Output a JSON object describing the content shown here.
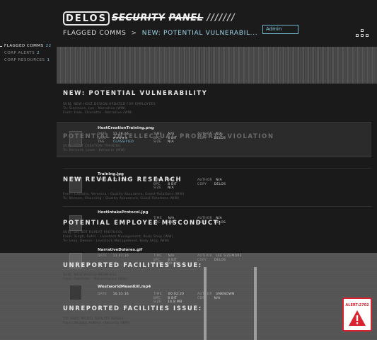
{
  "header": {
    "logo": "DELOS",
    "panel_title_word1": "SECURITY",
    "panel_title_word2": "PANEL",
    "panel_title_hashes": "///////",
    "admin_label": "Admin"
  },
  "breadcrumb": {
    "root": "FLAGGED COMMS",
    "separator": ">",
    "current": "NEW: POTENTIAL VULNERABIL..."
  },
  "sidebar": {
    "items": [
      {
        "label": "FLAGGED COMMS",
        "count": "22"
      },
      {
        "label": "CORP ALERTS",
        "count": "2"
      },
      {
        "label": "CORP RESOURCES",
        "count": "1"
      }
    ]
  },
  "messages": [
    {
      "title": "NEW: POTENTIAL VULNERABILITY",
      "lines": [
        "SUBJ: NEW HOST DESIGN UPDATED FOR EMPLOYEES",
        "To: Sizemore, Lee - Narrative (WW)",
        "From: Hale, Charlotte - Narrative (WW)"
      ]
    },
    {
      "title": "POTENTIAL INTELLECTUAL PROPERTY VIOLATION",
      "lines": [
        "SUBJ: HOST CREATION TRAINING",
        "To: Bernard, Lowe - Behavior (WW)"
      ]
    },
    {
      "title": "NEW REVEALING RESEARCH",
      "lines": [
        "From: Costello, Veronica - Quality Assurance, Guest Relations (WW)",
        "To: Benson, Channing - Quality Assurance, Guest Relations (WW)"
      ]
    },
    {
      "title": "POTENTIAL EMPLOYEE MISCONDUCT:",
      "lines": [
        "SUBJ: DO NOT REPEAT PROTOCOL",
        "From: Singh, Rohit - Livestock Management, Body Shop (WW)",
        "To: Levy, Dennis - Livestock Management, Body Shop (WW)"
      ]
    },
    {
      "title": "UNREPORTED FACILITIES ISSUE:",
      "lines": [
        "SUBJ: WESTWORLD MEAN KILL",
        "From: Facilities - Maintenance (WW)"
      ]
    },
    {
      "title": "UNREPORTED FACILITIES ISSUE:",
      "lines": [
        "TO: SUBJ: MODEL QUALITY ISSUES",
        "From: Stubbs, Ashley - Security (WW)"
      ]
    }
  ],
  "attachments": [
    {
      "name": "HostCreationTraining.png",
      "date": "11.28.16",
      "rate": "★★★★★",
      "tag": "CLASSIFIED",
      "time": "N/A",
      "bpc": "8 BIT",
      "size": "N/A",
      "author": "N/A",
      "copy": "DELOS"
    },
    {
      "name": "Training.jpg",
      "date": "11.21.16",
      "rate": "",
      "tag": "",
      "time": "N/A",
      "bpc": "8 BIT",
      "size": "N/A",
      "author": "N/A",
      "copy": "DELOS"
    },
    {
      "name": "HostIntakeProtocol.jpg",
      "date": "11.14.16",
      "rate": "",
      "tag": "",
      "time": "N/A",
      "bpc": "8 BIT",
      "size": "N/A",
      "author": "N/A",
      "copy": "DELOS"
    },
    {
      "name": "NarrativeDolores.gif",
      "date": "11.07.16",
      "rate": "",
      "tag": "",
      "time": "N/A",
      "bpc": "8 BIT",
      "size": "00:48",
      "author": "LEE SIZEMORE",
      "copy": "DELOS"
    },
    {
      "name": "WestworldMeanKill.mp4",
      "date": "10.31.16",
      "rate": "",
      "tag": "",
      "time": "00:02:20",
      "bpc": "8 BIT",
      "size": "14.8 MB",
      "author": "UNKNOWN",
      "copy": "N/A"
    }
  ],
  "meta_labels": {
    "date": "DATE",
    "rate": "RATE",
    "tag": "TAG",
    "time": "TIME",
    "bpc": "BPC",
    "size": "SIZE",
    "author": "AUTHOR",
    "copy": "COPY"
  },
  "alert": {
    "label": "ALERT:2702"
  },
  "colors": {
    "accent": "#7fbfd6",
    "alert": "#d9232e"
  }
}
